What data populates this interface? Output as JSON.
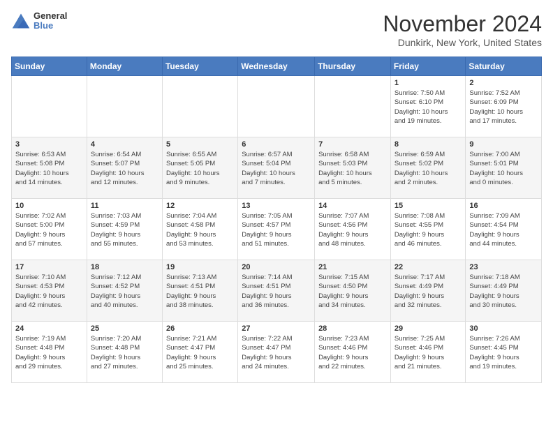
{
  "header": {
    "logo_general": "General",
    "logo_blue": "Blue",
    "month_title": "November 2024",
    "location": "Dunkirk, New York, United States"
  },
  "weekdays": [
    "Sunday",
    "Monday",
    "Tuesday",
    "Wednesday",
    "Thursday",
    "Friday",
    "Saturday"
  ],
  "weeks": [
    {
      "days": [
        {
          "num": "",
          "info": ""
        },
        {
          "num": "",
          "info": ""
        },
        {
          "num": "",
          "info": ""
        },
        {
          "num": "",
          "info": ""
        },
        {
          "num": "",
          "info": ""
        },
        {
          "num": "1",
          "info": "Sunrise: 7:50 AM\nSunset: 6:10 PM\nDaylight: 10 hours\nand 19 minutes."
        },
        {
          "num": "2",
          "info": "Sunrise: 7:52 AM\nSunset: 6:09 PM\nDaylight: 10 hours\nand 17 minutes."
        }
      ]
    },
    {
      "days": [
        {
          "num": "3",
          "info": "Sunrise: 6:53 AM\nSunset: 5:08 PM\nDaylight: 10 hours\nand 14 minutes."
        },
        {
          "num": "4",
          "info": "Sunrise: 6:54 AM\nSunset: 5:07 PM\nDaylight: 10 hours\nand 12 minutes."
        },
        {
          "num": "5",
          "info": "Sunrise: 6:55 AM\nSunset: 5:05 PM\nDaylight: 10 hours\nand 9 minutes."
        },
        {
          "num": "6",
          "info": "Sunrise: 6:57 AM\nSunset: 5:04 PM\nDaylight: 10 hours\nand 7 minutes."
        },
        {
          "num": "7",
          "info": "Sunrise: 6:58 AM\nSunset: 5:03 PM\nDaylight: 10 hours\nand 5 minutes."
        },
        {
          "num": "8",
          "info": "Sunrise: 6:59 AM\nSunset: 5:02 PM\nDaylight: 10 hours\nand 2 minutes."
        },
        {
          "num": "9",
          "info": "Sunrise: 7:00 AM\nSunset: 5:01 PM\nDaylight: 10 hours\nand 0 minutes."
        }
      ]
    },
    {
      "days": [
        {
          "num": "10",
          "info": "Sunrise: 7:02 AM\nSunset: 5:00 PM\nDaylight: 9 hours\nand 57 minutes."
        },
        {
          "num": "11",
          "info": "Sunrise: 7:03 AM\nSunset: 4:59 PM\nDaylight: 9 hours\nand 55 minutes."
        },
        {
          "num": "12",
          "info": "Sunrise: 7:04 AM\nSunset: 4:58 PM\nDaylight: 9 hours\nand 53 minutes."
        },
        {
          "num": "13",
          "info": "Sunrise: 7:05 AM\nSunset: 4:57 PM\nDaylight: 9 hours\nand 51 minutes."
        },
        {
          "num": "14",
          "info": "Sunrise: 7:07 AM\nSunset: 4:56 PM\nDaylight: 9 hours\nand 48 minutes."
        },
        {
          "num": "15",
          "info": "Sunrise: 7:08 AM\nSunset: 4:55 PM\nDaylight: 9 hours\nand 46 minutes."
        },
        {
          "num": "16",
          "info": "Sunrise: 7:09 AM\nSunset: 4:54 PM\nDaylight: 9 hours\nand 44 minutes."
        }
      ]
    },
    {
      "days": [
        {
          "num": "17",
          "info": "Sunrise: 7:10 AM\nSunset: 4:53 PM\nDaylight: 9 hours\nand 42 minutes."
        },
        {
          "num": "18",
          "info": "Sunrise: 7:12 AM\nSunset: 4:52 PM\nDaylight: 9 hours\nand 40 minutes."
        },
        {
          "num": "19",
          "info": "Sunrise: 7:13 AM\nSunset: 4:51 PM\nDaylight: 9 hours\nand 38 minutes."
        },
        {
          "num": "20",
          "info": "Sunrise: 7:14 AM\nSunset: 4:51 PM\nDaylight: 9 hours\nand 36 minutes."
        },
        {
          "num": "21",
          "info": "Sunrise: 7:15 AM\nSunset: 4:50 PM\nDaylight: 9 hours\nand 34 minutes."
        },
        {
          "num": "22",
          "info": "Sunrise: 7:17 AM\nSunset: 4:49 PM\nDaylight: 9 hours\nand 32 minutes."
        },
        {
          "num": "23",
          "info": "Sunrise: 7:18 AM\nSunset: 4:49 PM\nDaylight: 9 hours\nand 30 minutes."
        }
      ]
    },
    {
      "days": [
        {
          "num": "24",
          "info": "Sunrise: 7:19 AM\nSunset: 4:48 PM\nDaylight: 9 hours\nand 29 minutes."
        },
        {
          "num": "25",
          "info": "Sunrise: 7:20 AM\nSunset: 4:48 PM\nDaylight: 9 hours\nand 27 minutes."
        },
        {
          "num": "26",
          "info": "Sunrise: 7:21 AM\nSunset: 4:47 PM\nDaylight: 9 hours\nand 25 minutes."
        },
        {
          "num": "27",
          "info": "Sunrise: 7:22 AM\nSunset: 4:47 PM\nDaylight: 9 hours\nand 24 minutes."
        },
        {
          "num": "28",
          "info": "Sunrise: 7:23 AM\nSunset: 4:46 PM\nDaylight: 9 hours\nand 22 minutes."
        },
        {
          "num": "29",
          "info": "Sunrise: 7:25 AM\nSunset: 4:46 PM\nDaylight: 9 hours\nand 21 minutes."
        },
        {
          "num": "30",
          "info": "Sunrise: 7:26 AM\nSunset: 4:45 PM\nDaylight: 9 hours\nand 19 minutes."
        }
      ]
    }
  ]
}
